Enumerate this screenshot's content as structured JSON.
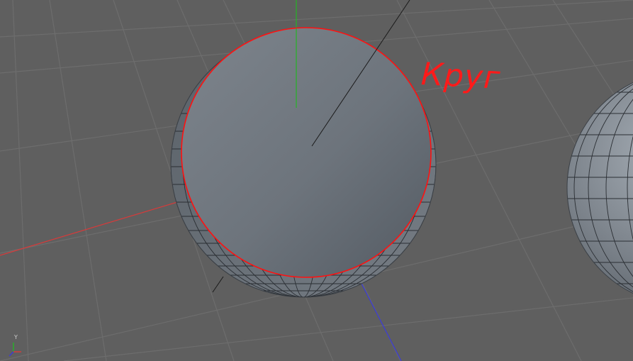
{
  "viewport": {
    "background": "#5f5f5f",
    "grid_color": "#6d6d6d",
    "axis_colors": {
      "x": "#d83a3a",
      "y": "#26b426",
      "z": "#3a3ad8"
    }
  },
  "annotation": {
    "text": "Круг",
    "color": "#ff1a1a"
  },
  "gizmo": {
    "y_label": "Y",
    "icon": "axis-gizmo-icon"
  },
  "objects": {
    "sphere_main": {
      "icon": "sphere-object"
    },
    "disc": {
      "icon": "circle-object",
      "outline_color": "#ff1111"
    },
    "sphere_secondary": {
      "icon": "sphere-object"
    }
  }
}
